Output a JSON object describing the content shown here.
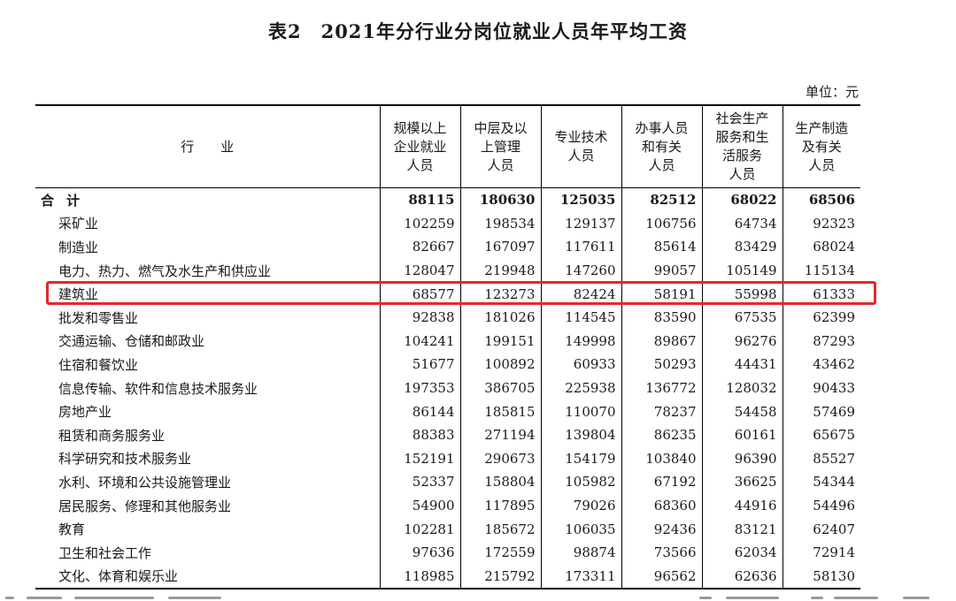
{
  "title": {
    "number": "表2",
    "text": "2021年分行业分岗位就业人员年平均工资"
  },
  "unit": "单位：元",
  "columns": [
    "行业",
    "规模以上\n企业就业\n人员",
    "中层及以\n上管理\n人员",
    "专业技术\n人员",
    "办事人员\n和有关\n人员",
    "社会生产\n服务和生\n活服务\n人员",
    "生产制造\n及有关\n人员"
  ],
  "rows": [
    [
      "合计",
      "88115",
      "180630",
      "125035",
      "82512",
      "68022",
      "68506"
    ],
    [
      "采矿业",
      "102259",
      "198534",
      "129137",
      "106756",
      "64734",
      "92323"
    ],
    [
      "制造业",
      "82667",
      "167097",
      "117611",
      "85614",
      "83429",
      "68024"
    ],
    [
      "电力、热力、燃气及水生产和供应业",
      "128047",
      "219948",
      "147260",
      "99057",
      "105149",
      "115134"
    ],
    [
      "建筑业",
      "68577",
      "123273",
      "82424",
      "58191",
      "55998",
      "61333"
    ],
    [
      "批发和零售业",
      "92838",
      "181026",
      "114545",
      "83590",
      "67535",
      "62399"
    ],
    [
      "交通运输、仓储和邮政业",
      "104241",
      "199151",
      "149998",
      "89867",
      "96276",
      "87293"
    ],
    [
      "住宿和餐饮业",
      "51677",
      "100892",
      "60933",
      "50293",
      "44431",
      "43462"
    ],
    [
      "信息传输、软件和信息技术服务业",
      "197353",
      "386705",
      "225938",
      "136772",
      "128032",
      "90433"
    ],
    [
      "房地产业",
      "86144",
      "185815",
      "110070",
      "78237",
      "54458",
      "57469"
    ],
    [
      "租赁和商务服务业",
      "88383",
      "271194",
      "139804",
      "86235",
      "60161",
      "65675"
    ],
    [
      "科学研究和技术服务业",
      "152191",
      "290673",
      "154179",
      "103840",
      "96390",
      "85527"
    ],
    [
      "水利、环境和公共设施管理业",
      "52337",
      "158804",
      "105982",
      "67192",
      "36625",
      "54344"
    ],
    [
      "居民服务、修理和其他服务业",
      "54900",
      "117895",
      "79026",
      "68360",
      "44916",
      "54496"
    ],
    [
      "教育",
      "102281",
      "185672",
      "106035",
      "92436",
      "83121",
      "62407"
    ],
    [
      "卫生和社会工作",
      "97636",
      "172559",
      "98874",
      "73566",
      "62034",
      "72914"
    ],
    [
      "文化、体育和娱乐业",
      "118985",
      "215792",
      "173311",
      "96562",
      "62636",
      "58130"
    ]
  ],
  "highlight": {
    "row_label": "建筑业",
    "color": "#e8262c"
  }
}
